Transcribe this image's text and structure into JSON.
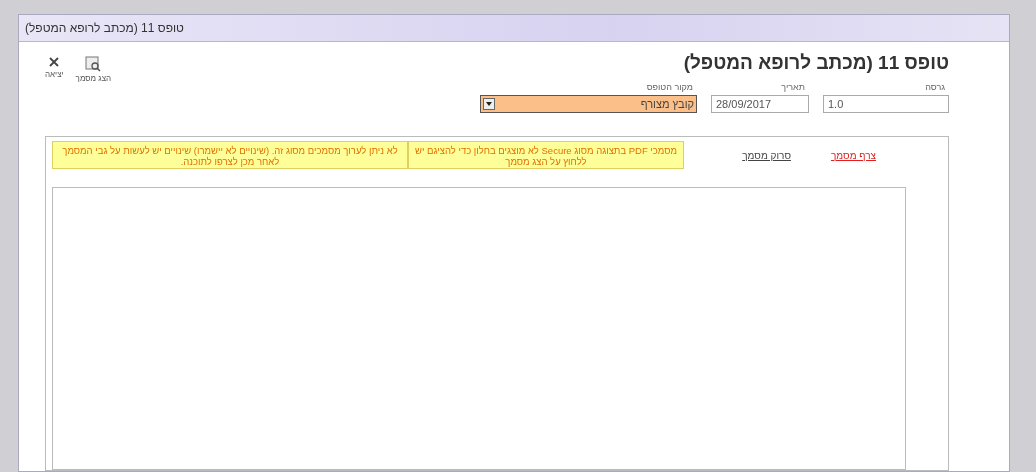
{
  "window": {
    "title": "טופס 11 (מכתב לרופא המטפל)"
  },
  "toolbar": [
    {
      "kind": "exit",
      "label": "יציאה"
    },
    {
      "kind": "preview",
      "label": "הצג מסמך"
    }
  ],
  "heading": "טופס 11 (מכתב לרופא המטפל)",
  "fields": {
    "version": {
      "label": "גרסה",
      "value": "1.0"
    },
    "date": {
      "label": "תאריך",
      "value": "28/09/2017"
    },
    "source": {
      "label": "מקור הטופס",
      "value": "קובץ מצורף"
    }
  },
  "tabs": [
    {
      "label": "צרף מסמך",
      "selected": true
    },
    {
      "label": "סרוק מסמך",
      "selected": false
    }
  ],
  "notes": [
    "מסמכי PDF בתצוגה מסוג Secure לא מוצגים בחלון כדי להציגם יש ללחוץ על הצג מסמך",
    "לא ניתן לערוך מסמכים מסוג זה. (שינויים לא יישמרו) שינויים יש לעשות על גבי המסמך לאחר מכן לצרפו לתוכנה."
  ]
}
